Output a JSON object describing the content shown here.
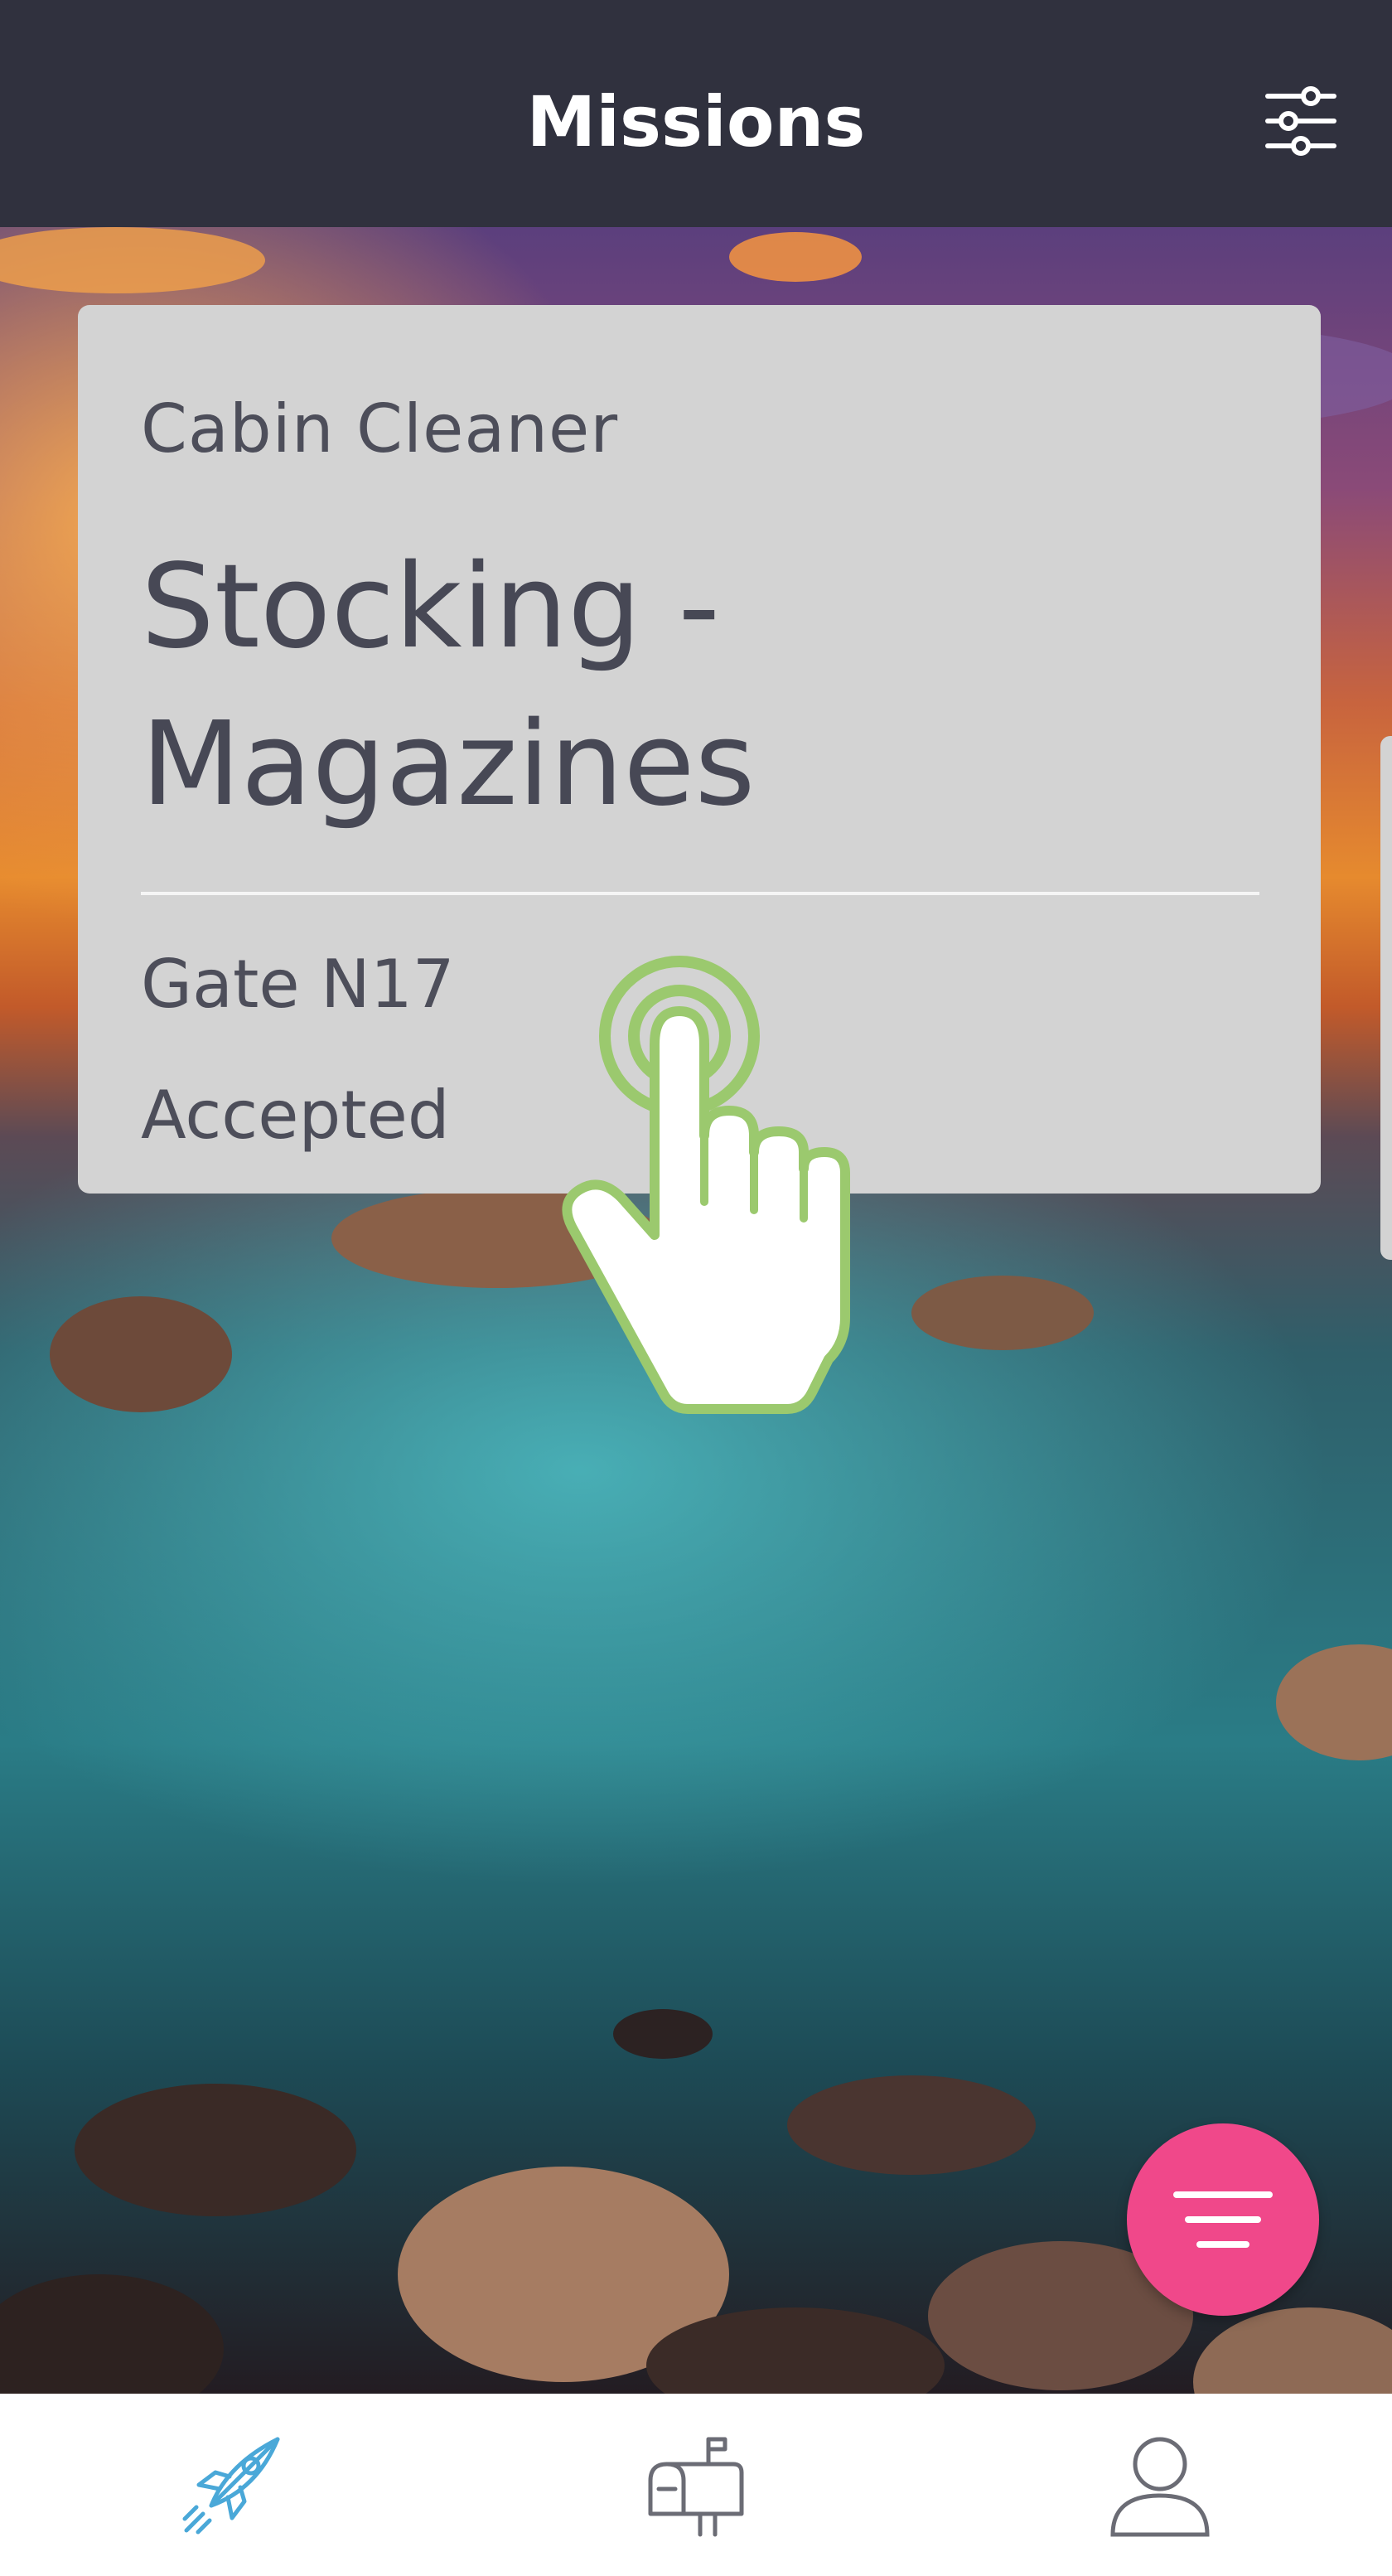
{
  "header": {
    "title": "Missions",
    "filter_icon": "sliders-icon"
  },
  "mission_card": {
    "role": "Cabin Cleaner",
    "title": "Stocking - Magazines",
    "location": "Gate N17",
    "status": "Accepted"
  },
  "overlay": {
    "icon": "tap-hand-icon",
    "color": "#9bc96e"
  },
  "fab": {
    "icon": "menu-lines-icon",
    "color": "#f0488a"
  },
  "bottom_nav": {
    "items": [
      {
        "icon": "rocket-icon",
        "active": true,
        "color": "#4aa8d8"
      },
      {
        "icon": "mailbox-icon",
        "active": false,
        "color": "#6b6c75"
      },
      {
        "icon": "user-icon",
        "active": false,
        "color": "#6b6c75"
      }
    ]
  },
  "colors": {
    "header_bg": "#30313e",
    "card_bg": "#d3d3d3",
    "text_dark": "#4d4e5a"
  }
}
